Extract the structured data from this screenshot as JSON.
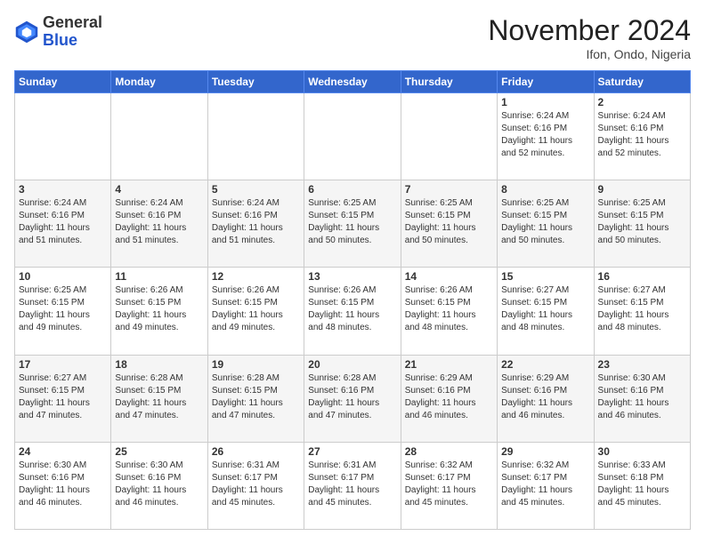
{
  "header": {
    "logo_general": "General",
    "logo_blue": "Blue",
    "month_title": "November 2024",
    "location": "Ifon, Ondo, Nigeria"
  },
  "days_of_week": [
    "Sunday",
    "Monday",
    "Tuesday",
    "Wednesday",
    "Thursday",
    "Friday",
    "Saturday"
  ],
  "weeks": [
    [
      {
        "day": "",
        "info": ""
      },
      {
        "day": "",
        "info": ""
      },
      {
        "day": "",
        "info": ""
      },
      {
        "day": "",
        "info": ""
      },
      {
        "day": "",
        "info": ""
      },
      {
        "day": "1",
        "info": "Sunrise: 6:24 AM\nSunset: 6:16 PM\nDaylight: 11 hours\nand 52 minutes."
      },
      {
        "day": "2",
        "info": "Sunrise: 6:24 AM\nSunset: 6:16 PM\nDaylight: 11 hours\nand 52 minutes."
      }
    ],
    [
      {
        "day": "3",
        "info": "Sunrise: 6:24 AM\nSunset: 6:16 PM\nDaylight: 11 hours\nand 51 minutes."
      },
      {
        "day": "4",
        "info": "Sunrise: 6:24 AM\nSunset: 6:16 PM\nDaylight: 11 hours\nand 51 minutes."
      },
      {
        "day": "5",
        "info": "Sunrise: 6:24 AM\nSunset: 6:16 PM\nDaylight: 11 hours\nand 51 minutes."
      },
      {
        "day": "6",
        "info": "Sunrise: 6:25 AM\nSunset: 6:15 PM\nDaylight: 11 hours\nand 50 minutes."
      },
      {
        "day": "7",
        "info": "Sunrise: 6:25 AM\nSunset: 6:15 PM\nDaylight: 11 hours\nand 50 minutes."
      },
      {
        "day": "8",
        "info": "Sunrise: 6:25 AM\nSunset: 6:15 PM\nDaylight: 11 hours\nand 50 minutes."
      },
      {
        "day": "9",
        "info": "Sunrise: 6:25 AM\nSunset: 6:15 PM\nDaylight: 11 hours\nand 50 minutes."
      }
    ],
    [
      {
        "day": "10",
        "info": "Sunrise: 6:25 AM\nSunset: 6:15 PM\nDaylight: 11 hours\nand 49 minutes."
      },
      {
        "day": "11",
        "info": "Sunrise: 6:26 AM\nSunset: 6:15 PM\nDaylight: 11 hours\nand 49 minutes."
      },
      {
        "day": "12",
        "info": "Sunrise: 6:26 AM\nSunset: 6:15 PM\nDaylight: 11 hours\nand 49 minutes."
      },
      {
        "day": "13",
        "info": "Sunrise: 6:26 AM\nSunset: 6:15 PM\nDaylight: 11 hours\nand 48 minutes."
      },
      {
        "day": "14",
        "info": "Sunrise: 6:26 AM\nSunset: 6:15 PM\nDaylight: 11 hours\nand 48 minutes."
      },
      {
        "day": "15",
        "info": "Sunrise: 6:27 AM\nSunset: 6:15 PM\nDaylight: 11 hours\nand 48 minutes."
      },
      {
        "day": "16",
        "info": "Sunrise: 6:27 AM\nSunset: 6:15 PM\nDaylight: 11 hours\nand 48 minutes."
      }
    ],
    [
      {
        "day": "17",
        "info": "Sunrise: 6:27 AM\nSunset: 6:15 PM\nDaylight: 11 hours\nand 47 minutes."
      },
      {
        "day": "18",
        "info": "Sunrise: 6:28 AM\nSunset: 6:15 PM\nDaylight: 11 hours\nand 47 minutes."
      },
      {
        "day": "19",
        "info": "Sunrise: 6:28 AM\nSunset: 6:15 PM\nDaylight: 11 hours\nand 47 minutes."
      },
      {
        "day": "20",
        "info": "Sunrise: 6:28 AM\nSunset: 6:16 PM\nDaylight: 11 hours\nand 47 minutes."
      },
      {
        "day": "21",
        "info": "Sunrise: 6:29 AM\nSunset: 6:16 PM\nDaylight: 11 hours\nand 46 minutes."
      },
      {
        "day": "22",
        "info": "Sunrise: 6:29 AM\nSunset: 6:16 PM\nDaylight: 11 hours\nand 46 minutes."
      },
      {
        "day": "23",
        "info": "Sunrise: 6:30 AM\nSunset: 6:16 PM\nDaylight: 11 hours\nand 46 minutes."
      }
    ],
    [
      {
        "day": "24",
        "info": "Sunrise: 6:30 AM\nSunset: 6:16 PM\nDaylight: 11 hours\nand 46 minutes."
      },
      {
        "day": "25",
        "info": "Sunrise: 6:30 AM\nSunset: 6:16 PM\nDaylight: 11 hours\nand 46 minutes."
      },
      {
        "day": "26",
        "info": "Sunrise: 6:31 AM\nSunset: 6:17 PM\nDaylight: 11 hours\nand 45 minutes."
      },
      {
        "day": "27",
        "info": "Sunrise: 6:31 AM\nSunset: 6:17 PM\nDaylight: 11 hours\nand 45 minutes."
      },
      {
        "day": "28",
        "info": "Sunrise: 6:32 AM\nSunset: 6:17 PM\nDaylight: 11 hours\nand 45 minutes."
      },
      {
        "day": "29",
        "info": "Sunrise: 6:32 AM\nSunset: 6:17 PM\nDaylight: 11 hours\nand 45 minutes."
      },
      {
        "day": "30",
        "info": "Sunrise: 6:33 AM\nSunset: 6:18 PM\nDaylight: 11 hours\nand 45 minutes."
      }
    ]
  ]
}
